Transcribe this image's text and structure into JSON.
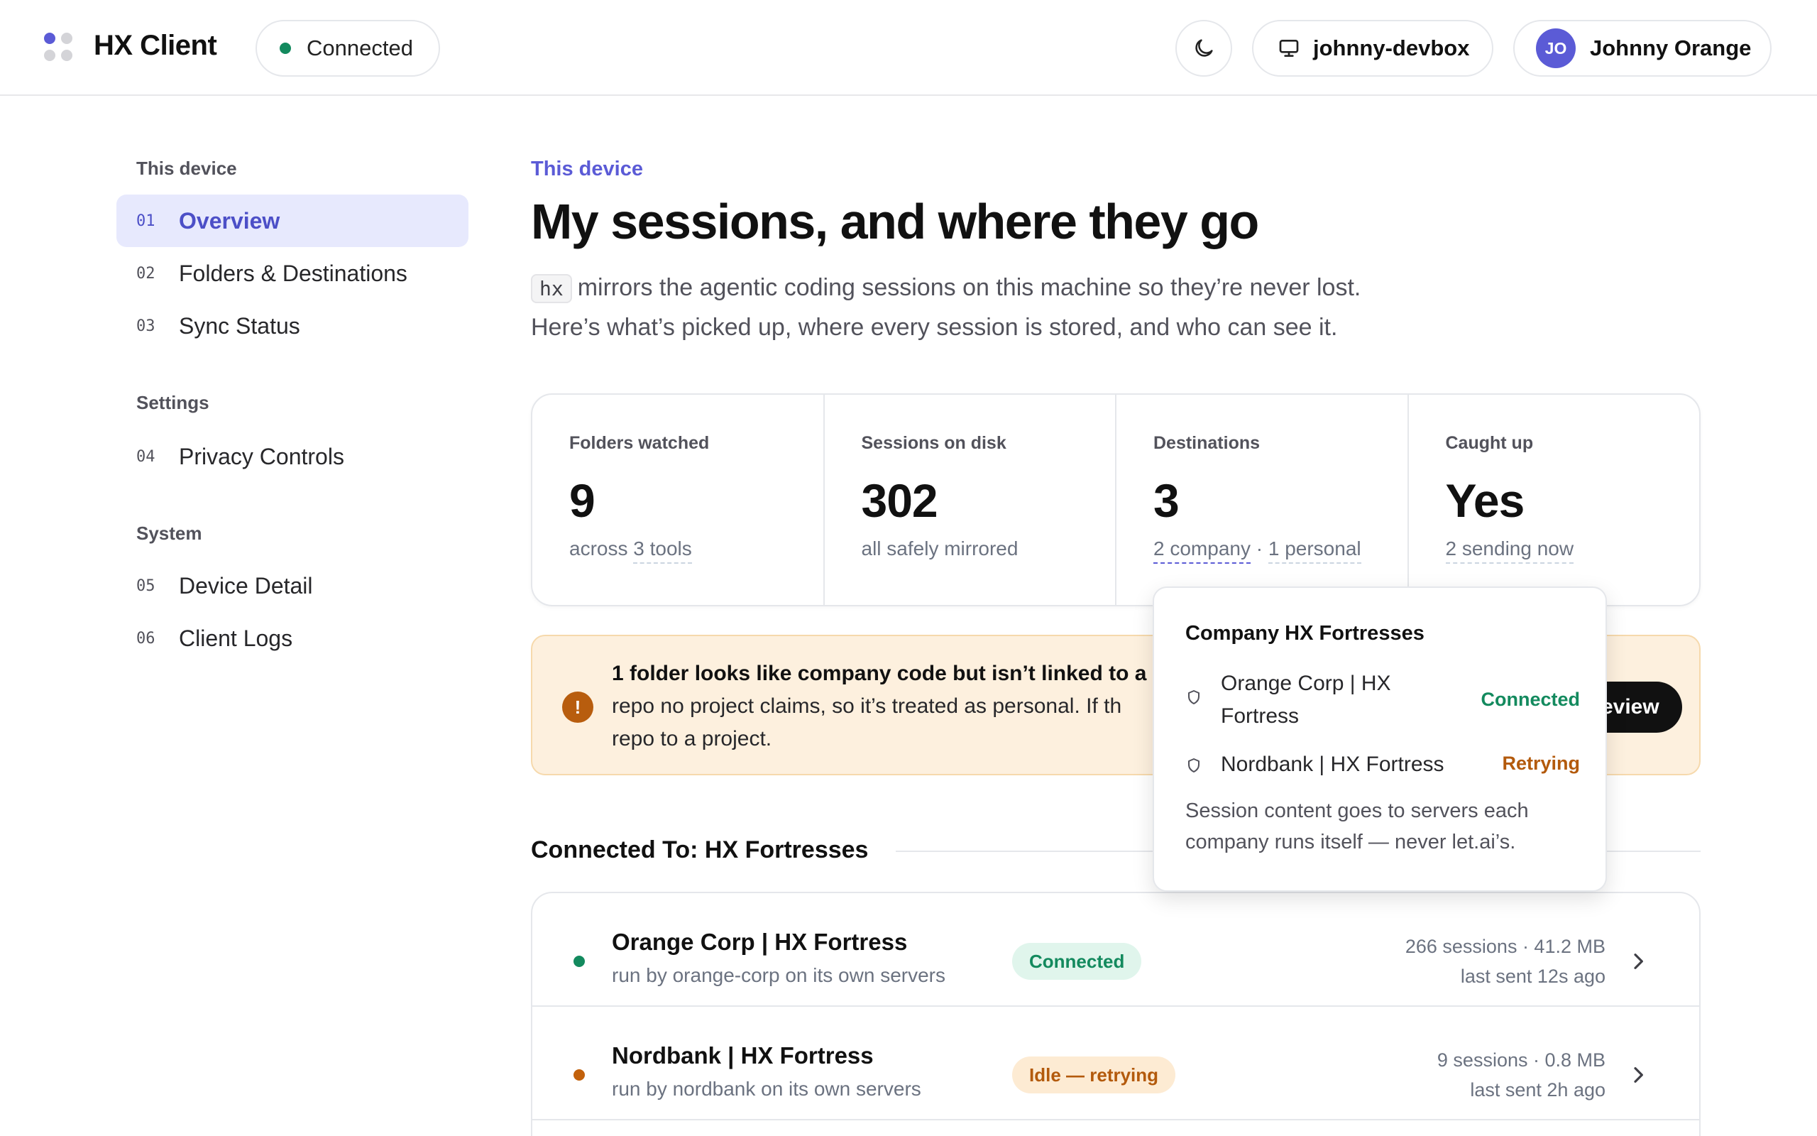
{
  "header": {
    "app_title": "HX Client",
    "connection_status": "Connected",
    "device_name": "johnny-devbox",
    "user_initials": "JO",
    "user_name": "Johnny Orange"
  },
  "sidebar": {
    "sections": [
      {
        "title": "This device",
        "items": [
          {
            "num": "01",
            "label": "Overview",
            "active": true
          },
          {
            "num": "02",
            "label": "Folders & Destinations"
          },
          {
            "num": "03",
            "label": "Sync Status"
          }
        ]
      },
      {
        "title": "Settings",
        "items": [
          {
            "num": "04",
            "label": "Privacy Controls"
          }
        ]
      },
      {
        "title": "System",
        "items": [
          {
            "num": "05",
            "label": "Device Detail"
          },
          {
            "num": "06",
            "label": "Client Logs"
          }
        ]
      }
    ]
  },
  "main": {
    "eyebrow": "This device",
    "title": "My sessions, and where they go",
    "lead_code": "hx",
    "lead_line1": "mirrors the agentic coding sessions on this machine so they’re never lost.",
    "lead_line2": "Here’s what’s picked up, where every session is stored, and who can see it."
  },
  "stats": [
    {
      "label": "Folders watched",
      "value": "9",
      "sub_pre": "across ",
      "sub_dash": "3 tools"
    },
    {
      "label": "Sessions on disk",
      "value": "302",
      "sub_pre": "all safely mirrored"
    },
    {
      "label": "Destinations",
      "value": "3",
      "sub_accent": "2 company",
      "sub_sep": " · ",
      "sub_dash": "1 personal"
    },
    {
      "label": "Caught up",
      "value": "Yes",
      "sub_dash": "2 sending now"
    }
  ],
  "alert": {
    "bold": "1 folder looks like company code but isn’t linked to a",
    "line2": "repo no project claims, so it’s treated as personal. If th",
    "line3": "repo to a project.",
    "button": "Review"
  },
  "destinations": {
    "title": "Connected To: HX Fortresses",
    "rows": [
      {
        "name": "Orange Corp | HX Fortress",
        "sub": "run by orange-corp on its own servers",
        "badge": "Connected",
        "stats1": "266 sessions · 41.2 MB",
        "stats2": "last sent 12s ago",
        "dot_color": "#138a5e"
      },
      {
        "name": "Nordbank | HX Fortress",
        "sub": "run by nordbank on its own servers",
        "badge": "Idle — retrying",
        "stats1": "9 sessions · 0.8 MB",
        "stats2": "last sent 2h ago",
        "dot_color": "#c2610c"
      }
    ]
  },
  "popover": {
    "title": "Company HX Fortresses",
    "items": [
      {
        "name_line1": "Orange Corp | HX",
        "name_line2": "Fortress",
        "status": "Connected",
        "color": "#138a5e"
      },
      {
        "name_line1": "Nordbank | HX Fortress",
        "status": "Retrying",
        "color": "#b35a0c"
      }
    ],
    "note_line1": "Session content goes to servers each",
    "note_line2": "company runs itself — never let.ai’s."
  },
  "icons": {
    "logo": "four-dot-logo",
    "theme": "moon-icon",
    "device": "monitor-icon",
    "alert": "exclamation-icon",
    "row_nav": "chevron-right-icon",
    "popover_item": "shield-icon"
  }
}
